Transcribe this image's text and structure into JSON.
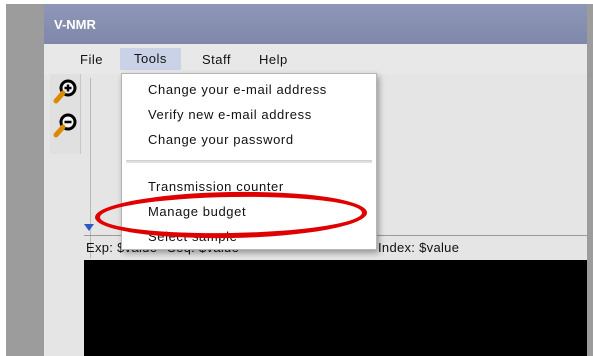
{
  "window": {
    "title": "V-NMR"
  },
  "menubar": {
    "items": [
      {
        "label": "File"
      },
      {
        "label": "Tools"
      },
      {
        "label": "Staff"
      },
      {
        "label": "Help"
      }
    ]
  },
  "toolbar": {
    "zoom_in_icon": "zoom-in-icon",
    "zoom_out_icon": "zoom-out-icon"
  },
  "tools_menu": {
    "items": [
      {
        "label": "Change your e-mail address"
      },
      {
        "label": "Verify new e-mail address"
      },
      {
        "label": "Change your password"
      },
      {
        "label": "Transmission counter"
      },
      {
        "label": "Manage budget"
      },
      {
        "label": "Select sample"
      }
    ]
  },
  "status": {
    "exp": "Exp: $value",
    "seq": "Seq: $value",
    "index": "Index: $value"
  },
  "colors": {
    "titlebar": "#8a92b4",
    "menu_active": "#c9d2e6",
    "highlight": "#e00000",
    "console_bg": "#000000"
  }
}
